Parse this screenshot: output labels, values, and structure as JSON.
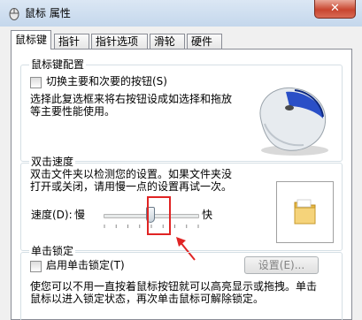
{
  "window": {
    "title": "鼠标 属性",
    "close_label": "✕"
  },
  "tabs": [
    {
      "label": "鼠标键",
      "active": true
    },
    {
      "label": "指针"
    },
    {
      "label": "指针选项"
    },
    {
      "label": "滑轮"
    },
    {
      "label": "硬件"
    }
  ],
  "button_config": {
    "title": "鼠标键配置",
    "swap_checkbox_label": "切换主要和次要的按钮(S)",
    "description_line1": "选择此复选框来将右按钮设成如选择和拖放",
    "description_line2": "等主要性能使用。"
  },
  "double_click": {
    "title": "双击速度",
    "description_line1": "双击文件夹以检测您的设置。如果文件夹没",
    "description_line2": "打开或关闭，请用慢一点的设置再试一次。",
    "speed_label": "速度(D):",
    "slow_label": "慢",
    "fast_label": "快",
    "speed_level": 0.5
  },
  "click_lock": {
    "title": "单击锁定",
    "checkbox_label": "启用单击锁定(T)",
    "settings_button": "设置(E)...",
    "description_line1": "使您可以不用一直按着鼠标按钮就可以高亮显示或拖拽。单击",
    "description_line2": "鼠标以进入锁定状态，再次单击鼠标可解除锁定。"
  },
  "colors": {
    "annotation": "#e02424",
    "folder": "#f2c84b"
  }
}
